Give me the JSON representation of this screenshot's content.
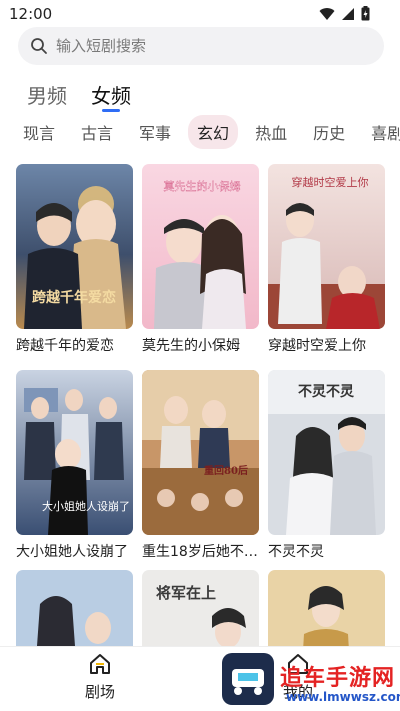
{
  "status_bar": {
    "time": "12:00"
  },
  "search": {
    "placeholder": "输入短剧搜索"
  },
  "channel_tabs": [
    {
      "label": "男频",
      "active": false
    },
    {
      "label": "女频",
      "active": true
    }
  ],
  "genre_tabs": [
    {
      "label": "现言",
      "active": false
    },
    {
      "label": "古言",
      "active": false
    },
    {
      "label": "军事",
      "active": false
    },
    {
      "label": "玄幻",
      "active": true
    },
    {
      "label": "热血",
      "active": false
    },
    {
      "label": "历史",
      "active": false
    },
    {
      "label": "喜剧",
      "active": false
    }
  ],
  "dramas": [
    {
      "title": "跨越千年的爱恋",
      "poster_text": "跨越千年爱恋"
    },
    {
      "title": "莫先生的小保姆",
      "poster_text": "莫先生的小保姆"
    },
    {
      "title": "穿越时空爱上你",
      "poster_text": "穿越时空爱上你"
    },
    {
      "title": "大小姐她人设崩了",
      "poster_text": "大小姐她人设崩了"
    },
    {
      "title": "重生18岁后她不…",
      "poster_text": "重回80后"
    },
    {
      "title": "不灵不灵",
      "poster_text": "不灵不灵"
    },
    {
      "title": "",
      "poster_text": ""
    },
    {
      "title": "",
      "poster_text": "将军在上"
    },
    {
      "title": "",
      "poster_text": ""
    }
  ],
  "bottom_nav": [
    {
      "label": "剧场",
      "icon": "home-icon"
    },
    {
      "label": "我的",
      "icon": "home-icon"
    }
  ],
  "watermark": {
    "title": "追车手游网",
    "url": "www.lmwwsz.com"
  },
  "colors": {
    "accent": "#2f6df5",
    "genre_active_bg": "#f7e6ea",
    "watermark_red": "#e42323",
    "watermark_blue": "#2456c8"
  }
}
